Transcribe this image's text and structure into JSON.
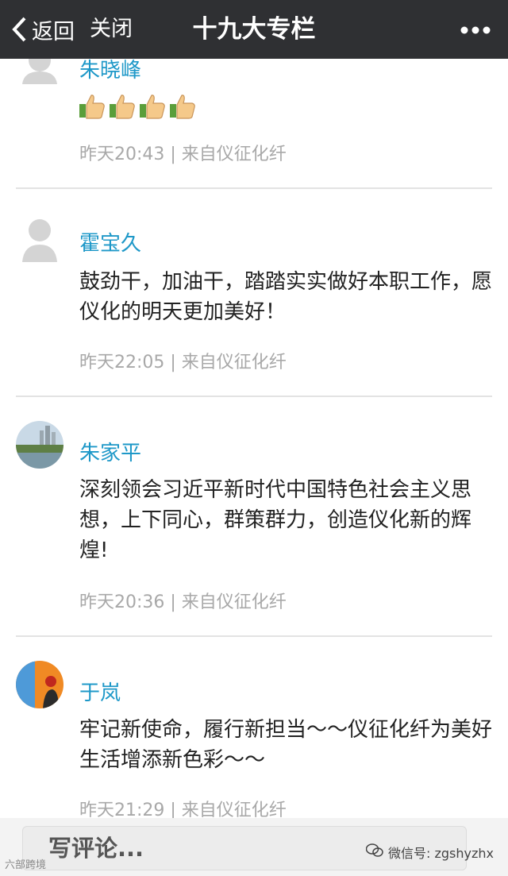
{
  "navbar": {
    "back_label": "返回",
    "close_label": "关闭",
    "title": "十九大专栏"
  },
  "comments": [
    {
      "author": "朱晓峰",
      "content": "",
      "reaction": "thumbs-up",
      "reaction_count": 4,
      "meta": "昨天20:43 | 来自仪征化纤"
    },
    {
      "author": "霍宝久",
      "content": "鼓劲干，加油干，踏踏实实做好本职工作，愿仪化的明天更加美好！",
      "meta": "昨天22:05 | 来自仪征化纤"
    },
    {
      "author": "朱家平",
      "content": "深刻领会习近平新时代中国特色社会主义思想，上下同心，群策群力，创造仪化新的辉煌!",
      "meta": "昨天20:36 | 来自仪征化纤"
    },
    {
      "author": "于岚",
      "content": "牢记新使命，履行新担当～～仪征化纤为美好生活增添新色彩～～",
      "meta": "昨天21:29 | 来自仪征化纤"
    }
  ],
  "footer": {
    "comment_placeholder": "写评论...",
    "watermark_left": "六部跨境",
    "watermark_right": "微信号: zgshyzhx"
  },
  "colors": {
    "navbar": "#2f3033",
    "author": "#1e98c8",
    "meta": "#a8a8a8"
  }
}
